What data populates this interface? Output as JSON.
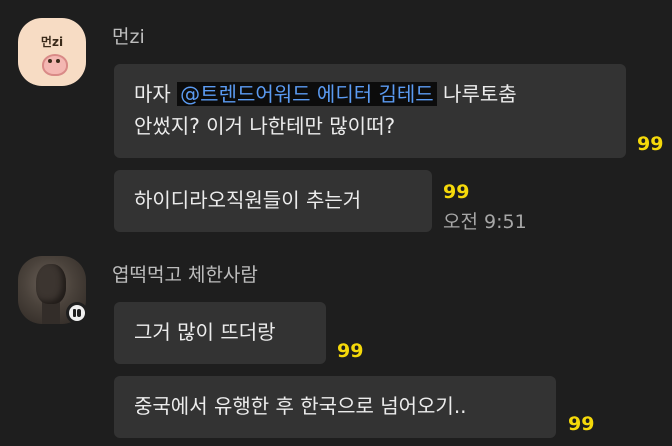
{
  "avatar_1": {
    "text": "먼zi"
  },
  "messages": [
    {
      "sender": "먼zi",
      "bubbles": [
        {
          "line1_before": "마자 ",
          "mention": "@트렌드어워드 에디터 김테드",
          "line1_after": "  나루토춤",
          "line2": "안썼지? 이거 나한테만 많이떠?",
          "unread": "99"
        },
        {
          "text": "하이디라오직원들이 추는거",
          "unread": "99",
          "time": "오전 9:51"
        }
      ]
    },
    {
      "sender": "엽떡먹고 체한사람",
      "bubbles": [
        {
          "text": "그거 많이 뜨더랑",
          "unread": "99"
        },
        {
          "text": "중국에서 유행한 후 한국으로 넘어오기..",
          "unread": "99"
        }
      ]
    }
  ]
}
